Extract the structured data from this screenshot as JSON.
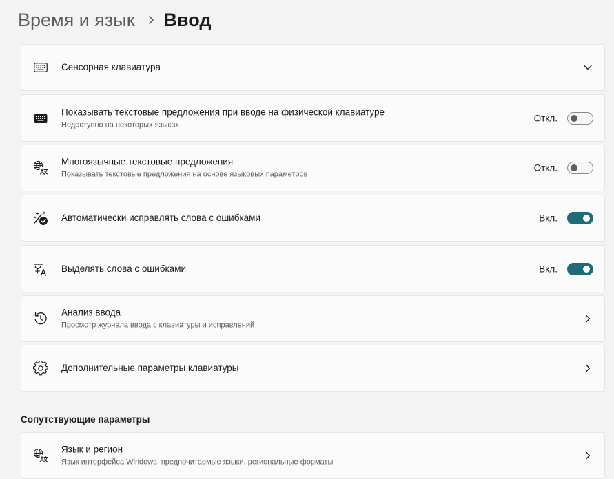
{
  "header": {
    "parent": "Время и язык",
    "current": "Ввод"
  },
  "rows": [
    {
      "title": "Сенсорная клавиатура",
      "icon": "touch-keyboard-icon",
      "action": "expand"
    },
    {
      "title": "Показывать текстовые предложения при вводе на физической клавиатуре",
      "subtitle": "Недоступно на некоторых языках",
      "icon": "keyboard-icon",
      "state": "Откл.",
      "on": false
    },
    {
      "title": "Многоязычные текстовые предложения",
      "subtitle": "Показывать текстовые предложения на основе языковых параметров",
      "icon": "language-icon",
      "state": "Откл.",
      "on": false
    },
    {
      "title": "Автоматически исправлять слова с ошибками",
      "icon": "autocorrect-icon",
      "state": "Вкл.",
      "on": true
    },
    {
      "title": "Выделять слова с ошибками",
      "icon": "spelling-highlight-icon",
      "state": "Вкл.",
      "on": true
    },
    {
      "title": "Анализ ввода",
      "subtitle": "Просмотр журнала ввода с клавиатуры и исправлений",
      "icon": "history-icon",
      "action": "navigate"
    },
    {
      "title": "Дополнительные параметры клавиатуры",
      "icon": "gear-icon",
      "action": "navigate"
    }
  ],
  "related": {
    "section_title": "Сопутствующие параметры",
    "items": [
      {
        "title": "Язык и регион",
        "subtitle": "Язык интерфейса Windows, предпочитаемые языки, региональные форматы",
        "icon": "language-icon",
        "action": "navigate"
      }
    ]
  },
  "colors": {
    "accent": "#1e6b79",
    "background": "#f3f3f3",
    "card": "#fbfbfb"
  }
}
